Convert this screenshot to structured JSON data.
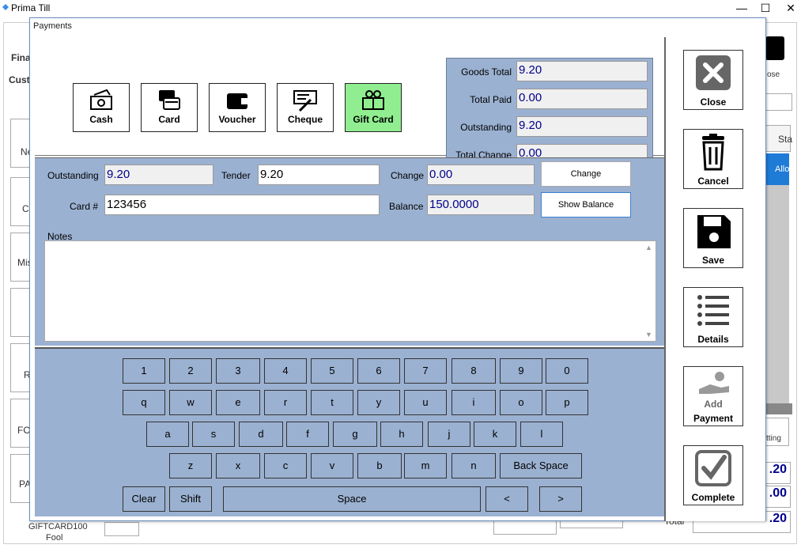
{
  "app": {
    "title": "Prima Till"
  },
  "background": {
    "left_labels": [
      "Fina",
      "Cust"
    ],
    "side_items": [
      "Ne",
      "C",
      "Mis",
      "",
      "R",
      "FO",
      "PA"
    ],
    "gift_line": "GIFTCARD100",
    "gift_line2": "Fool",
    "right_close": "ose",
    "right_status_header": "Sta",
    "right_status_value": "Allo",
    "setting_label": "tting",
    "totals": [
      ".20",
      ".00",
      ".20"
    ],
    "total_label": "Total"
  },
  "dialog": {
    "title": "Payments",
    "tender_types": [
      {
        "label": "Cash",
        "icon": "cash-icon",
        "active": false
      },
      {
        "label": "Card",
        "icon": "card-icon",
        "active": false
      },
      {
        "label": "Voucher",
        "icon": "wallet-icon",
        "active": false
      },
      {
        "label": "Cheque",
        "icon": "cheque-icon",
        "active": false
      },
      {
        "label": "Gift Card",
        "icon": "gift-card-icon",
        "active": true
      }
    ],
    "totals": {
      "goods_total_label": "Goods Total",
      "goods_total": "9.20",
      "total_paid_label": "Total Paid",
      "total_paid": "0.00",
      "outstanding_label": "Outstanding",
      "outstanding": "9.20",
      "total_change_label": "Total Change",
      "total_change": "0.00"
    },
    "form": {
      "outstanding_label": "Outstanding",
      "outstanding": "9.20",
      "tender_label": "Tender",
      "tender": "9.20",
      "change_label": "Change",
      "change": "0.00",
      "change_button": "Change",
      "card_label": "Card #",
      "card": "123456",
      "balance_label": "Balance",
      "balance": "150.0000",
      "show_balance_button": "Show Balance",
      "notes_label": "Notes",
      "notes": ""
    },
    "keyboard": {
      "row1": [
        "1",
        "2",
        "3",
        "4",
        "5",
        "6",
        "7",
        "8",
        "9",
        "0"
      ],
      "row2": [
        "q",
        "w",
        "e",
        "r",
        "t",
        "y",
        "u",
        "i",
        "o",
        "p"
      ],
      "row3": [
        "a",
        "s",
        "d",
        "f",
        "g",
        "h",
        "j",
        "k",
        "l"
      ],
      "row4": [
        "z",
        "x",
        "c",
        "v",
        "b",
        "m",
        "n"
      ],
      "backspace": "Back Space",
      "clear": "Clear",
      "shift": "Shift",
      "space": "Space",
      "left": "<",
      "right": ">"
    },
    "actions": {
      "close": "Close",
      "cancel": "Cancel",
      "save": "Save",
      "details": "Details",
      "add_payment_1": "Add",
      "add_payment_2": "Payment",
      "complete": "Complete"
    }
  }
}
